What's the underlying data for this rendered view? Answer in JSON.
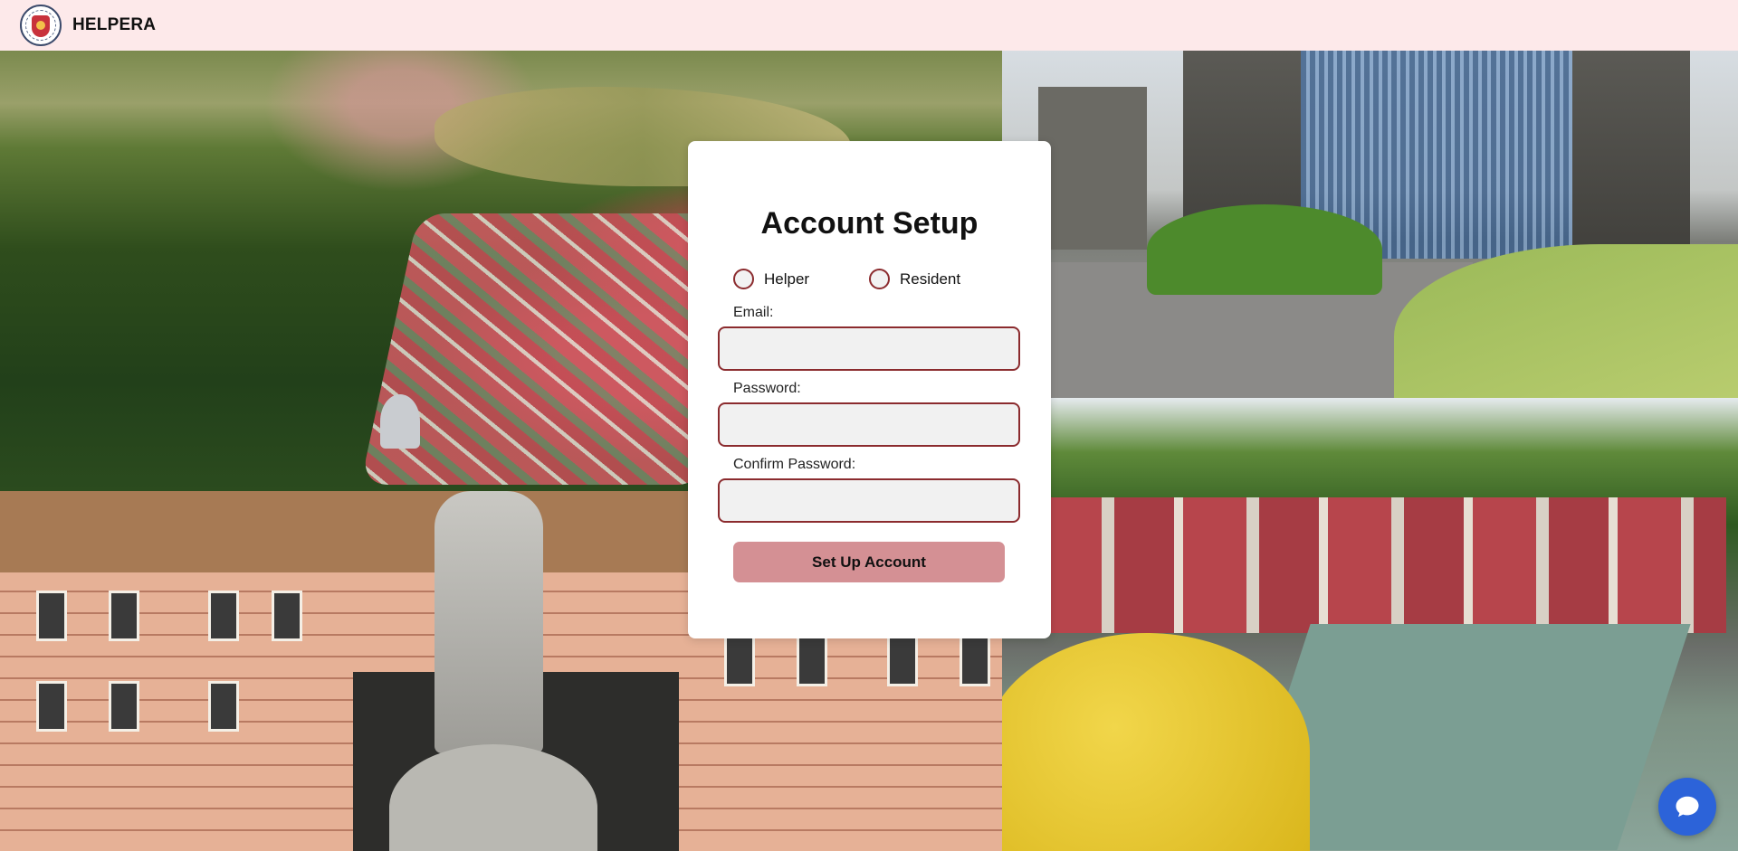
{
  "header": {
    "brand": "HELPERA",
    "logo_icon": "helpera-crest-logo",
    "background_color": "#fde9ea"
  },
  "form": {
    "title": "Account Setup",
    "role_options": [
      {
        "label": "Helper",
        "selected": false
      },
      {
        "label": "Resident",
        "selected": false
      }
    ],
    "fields": [
      {
        "label": "Email:",
        "value": "",
        "placeholder": "",
        "type": "email"
      },
      {
        "label": "Password:",
        "value": "",
        "placeholder": "",
        "type": "password"
      },
      {
        "label": "Confirm Password:",
        "value": "",
        "placeholder": "",
        "type": "password"
      }
    ],
    "submit_label": "Set Up Account",
    "accent_color": "#8b2b2e",
    "button_color": "#d49094"
  },
  "chat": {
    "icon": "chat-bubble-icon",
    "color": "#2c63d9"
  }
}
